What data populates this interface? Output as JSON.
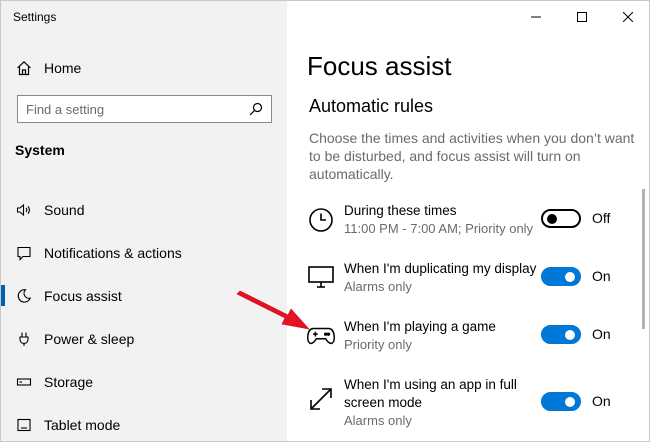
{
  "window": {
    "title": "Settings"
  },
  "sidebar": {
    "home_label": "Home",
    "search_placeholder": "Find a setting",
    "section_heading": "System",
    "items": [
      {
        "label": "Sound",
        "icon": "speaker-icon"
      },
      {
        "label": "Notifications & actions",
        "icon": "notifications-icon"
      },
      {
        "label": "Focus assist",
        "icon": "moon-icon",
        "active": true
      },
      {
        "label": "Power & sleep",
        "icon": "power-icon"
      },
      {
        "label": "Storage",
        "icon": "storage-icon"
      },
      {
        "label": "Tablet mode",
        "icon": "tablet-icon"
      }
    ]
  },
  "main": {
    "page_title": "Focus assist",
    "section_title": "Automatic rules",
    "description": "Choose the times and activities when you don’t want to be disturbed, and focus assist will turn on automatically.",
    "rules": [
      {
        "title": "During these times",
        "subtitle": "11:00 PM - 7:00 AM; Priority only",
        "state": "Off",
        "on": false,
        "icon": "clock-icon"
      },
      {
        "title": "When I'm duplicating my display",
        "subtitle": "Alarms only",
        "state": "On",
        "on": true,
        "icon": "monitor-icon"
      },
      {
        "title": "When I'm playing a game",
        "subtitle": "Priority only",
        "state": "On",
        "on": true,
        "icon": "gamepad-icon"
      },
      {
        "title": "When I'm using an app in full screen mode",
        "subtitle": "Alarms only",
        "state": "On",
        "on": true,
        "icon": "fullscreen-icon"
      }
    ]
  },
  "colors": {
    "accent": "#0078d7",
    "sidebar_bg": "#f2f2f2",
    "annotation_arrow": "#e81123"
  }
}
